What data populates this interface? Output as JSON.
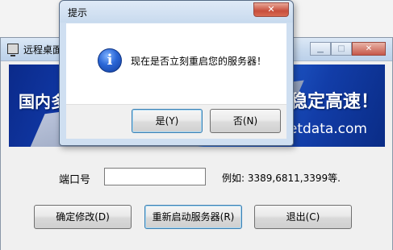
{
  "main_window": {
    "title": "远程桌面",
    "banner": {
      "left_text": "国内多",
      "right_text": "，稳定高速！",
      "url_text": "etdata.com"
    },
    "port_label": "端口号",
    "port_value": "",
    "port_hint": "例如: 3389,6811,3399等.",
    "buttons": {
      "confirm": "确定修改(D)",
      "restart": "重新启动服务器(R)",
      "exit": "退出(C)"
    }
  },
  "dialog": {
    "title": "提示",
    "message": "现在是否立刻重启您的服务器！",
    "icon": "info-icon",
    "yes_label": "是(Y)",
    "no_label": "否(N)"
  },
  "colors": {
    "banner_blue": "#1546c0",
    "dialog_frame": "#cfdff1",
    "close_red": "#c84e3c"
  }
}
